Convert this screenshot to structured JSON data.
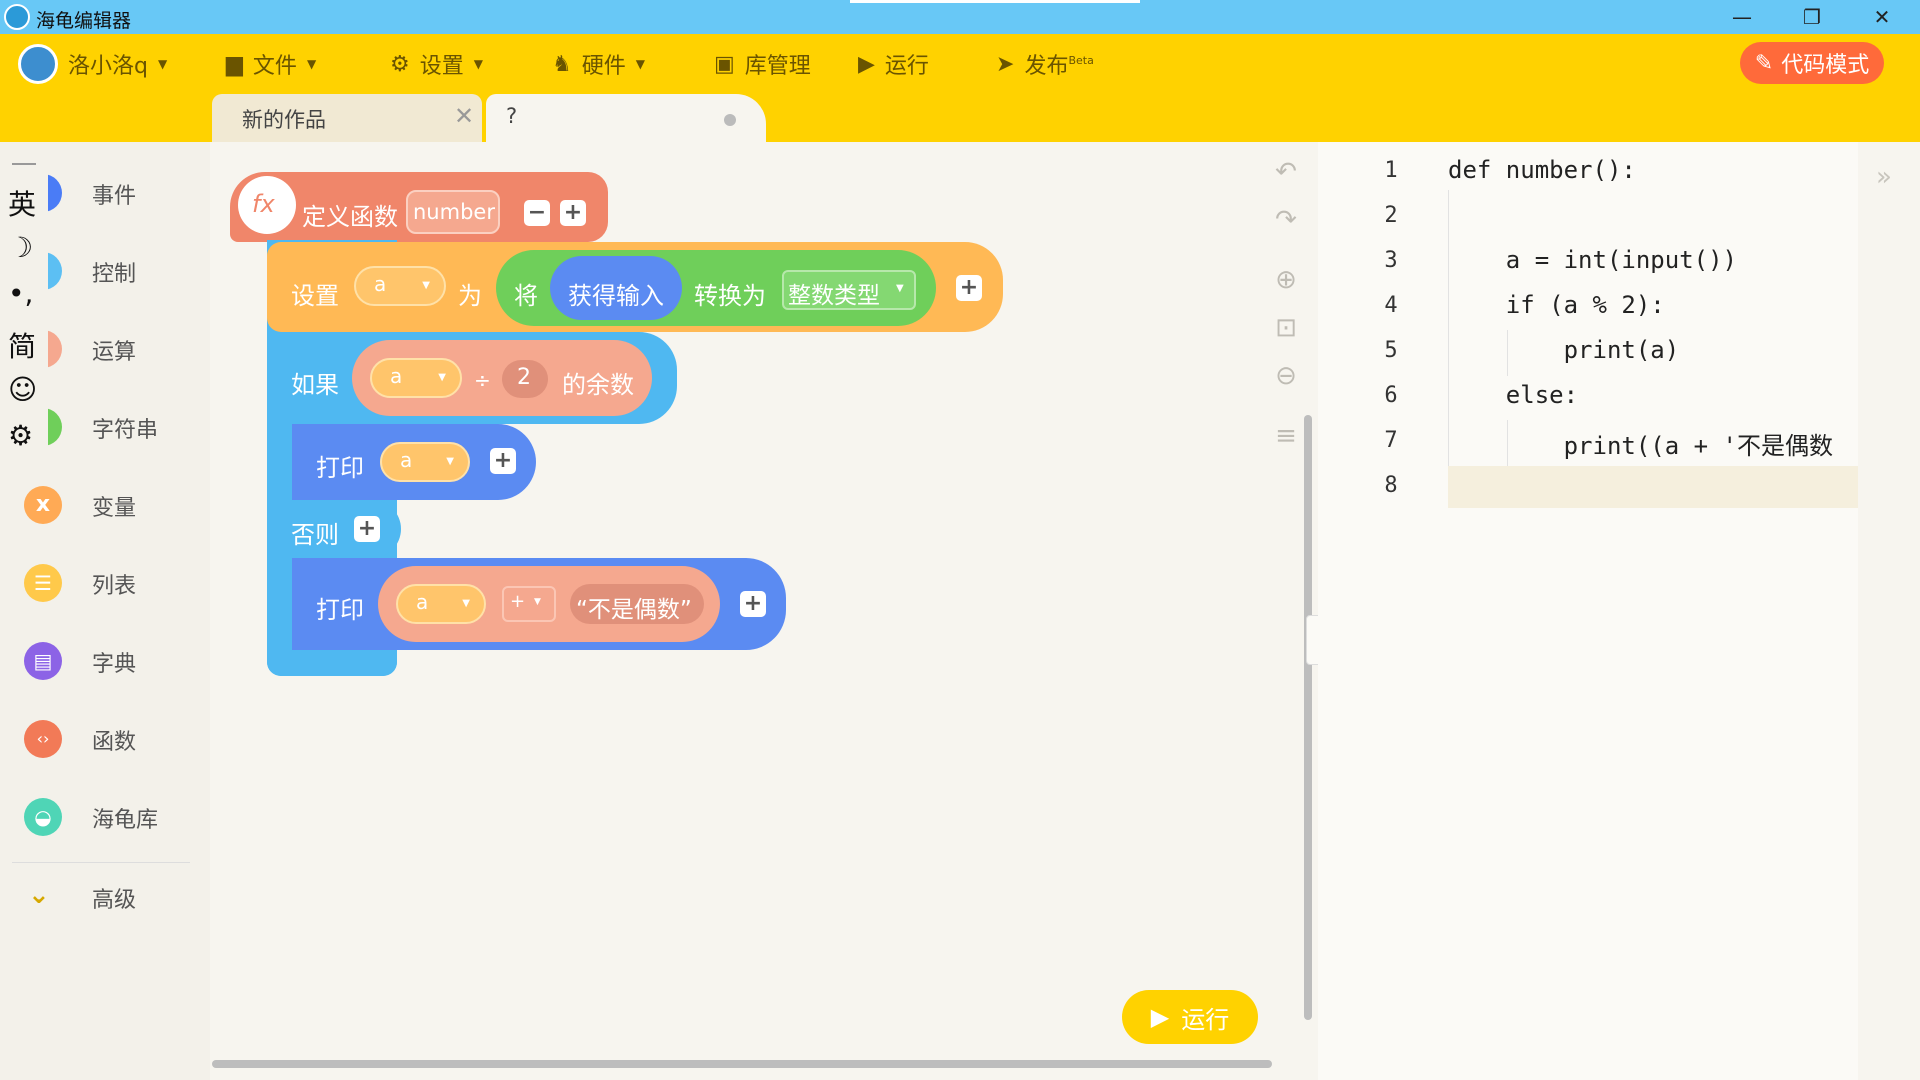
{
  "window": {
    "title": "海龟编辑器",
    "minimize": "—",
    "restore": "❐",
    "close": "✕"
  },
  "menu": {
    "user": "洛小洛q",
    "file": "文件",
    "settings": "设置",
    "hardware": "硬件",
    "library": "库管理",
    "run": "运行",
    "publish": "发布",
    "publish_badge": "Beta",
    "code_mode": "代码模式"
  },
  "tabs": [
    {
      "label": "新的作品",
      "close": "✕"
    },
    {
      "label": "?"
    }
  ],
  "ime": [
    "英",
    "☽",
    "•,",
    "简",
    "☺",
    "⚙"
  ],
  "categories": [
    {
      "label": "事件",
      "color": "#4a7cf6"
    },
    {
      "label": "控制",
      "color": "#5cbff3"
    },
    {
      "label": "运算",
      "color": "#f5a88f"
    },
    {
      "label": "字符串",
      "color": "#6fcf5a"
    },
    {
      "label": "变量",
      "color": "#ffaa55"
    },
    {
      "label": "列表",
      "color": "#ffc94a"
    },
    {
      "label": "字典",
      "color": "#8c63e6"
    },
    {
      "label": "函数",
      "color": "#f27a57"
    },
    {
      "label": "海龟库",
      "color": "#4fd5b6"
    },
    {
      "label": "高级",
      "color": "#d6a800"
    }
  ],
  "blocks": {
    "def_label": "定义函数",
    "func_name": "number",
    "fx": "fx",
    "set_label": "设置",
    "var_a": "a",
    "as_label": "为",
    "convert_label": "将",
    "input_label": "获得输入",
    "to_label": "转换为",
    "type_label": "整数类型",
    "if_label": "如果",
    "div_op": "÷",
    "two": "2",
    "remainder": "的余数",
    "print_label": "打印",
    "else_label": "否则",
    "plus_op": "+",
    "str_value": "“不是偶数”",
    "plus": "+",
    "minus": "−"
  },
  "workspace": {
    "run_button": "运行"
  },
  "code": {
    "line_numbers": [
      "1",
      "2",
      "3",
      "4",
      "5",
      "6",
      "7",
      "8"
    ],
    "lines": [
      "def number():",
      "",
      "    a = int(input())",
      "    if (a % 2):",
      "        print(a)",
      "    else:",
      "        print((a + '不是偶数",
      ""
    ]
  }
}
